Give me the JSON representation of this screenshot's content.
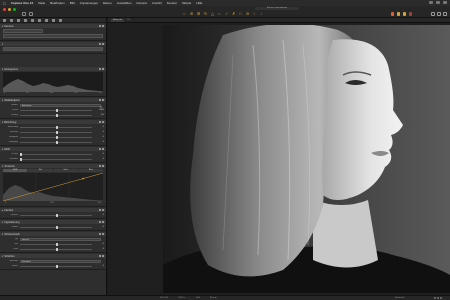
{
  "menubar": {
    "app_name": "Capture One 12",
    "items": [
      "Datei",
      "Bearbeiten",
      "Bild",
      "Anpassungen",
      "Ebene",
      "Auswählen",
      "Kamera",
      "Ansicht",
      "Fenster",
      "Skripte",
      "Hilfe"
    ]
  },
  "window_title": "Bettina ueberarbeitet",
  "viewer": {
    "tab_active": "Bettina.tif",
    "tab_other": "Fit"
  },
  "left_panel": {
    "header_label": "Kamera",
    "sections": {
      "histogram": {
        "title": "Histogramm",
        "scale": [
          "0",
          "64",
          "128",
          "192",
          "255"
        ]
      },
      "white_balance": {
        "title": "Weißabgleich",
        "mode_label": "Modus",
        "mode_value": "Aufnahme",
        "rows": [
          {
            "label": "Kelvin",
            "value": "5000"
          },
          {
            "label": "Tönung",
            "value": "0,0"
          }
        ]
      },
      "exposure": {
        "title": "Belichtung",
        "rows": [
          {
            "label": "Belichtung",
            "value": "0"
          },
          {
            "label": "Kontrast",
            "value": "0"
          },
          {
            "label": "Helligkeit",
            "value": "0"
          },
          {
            "label": "Sättigung",
            "value": "0"
          }
        ]
      },
      "hdr": {
        "title": "HDR",
        "rows": [
          {
            "label": "Lichter",
            "value": "0"
          },
          {
            "label": "Schatten",
            "value": "0"
          }
        ]
      },
      "curve": {
        "title": "Tonwerte",
        "tabs": [
          "RGB",
          "Rot",
          "Grün",
          "Blau"
        ],
        "vals": [
          "0",
          "128",
          "255"
        ]
      },
      "clarity": {
        "title": "Klarheit",
        "rows": [
          {
            "label": "Klarheit",
            "value": "0"
          }
        ]
      },
      "vignette": {
        "title": "Vignettierung",
        "rows": [
          {
            "label": "Stärke",
            "value": "0"
          }
        ]
      },
      "bw": {
        "title": "Schwarzweiß",
        "mode_label": "Typ",
        "mode_value": "Neutral",
        "rows": [
          {
            "label": "Rot",
            "value": "0"
          },
          {
            "label": "Gelb",
            "value": "0"
          }
        ]
      },
      "sharpen": {
        "title": "Schärfen",
        "mode_label": "Methode",
        "mode_value": "Standard",
        "rows": [
          {
            "label": "Stärke",
            "value": "0"
          }
        ]
      }
    }
  },
  "status": {
    "left": "ISO 100",
    "mid1": "1/125 s",
    "mid2": "f/5,6",
    "mid3": "85 mm",
    "right": "Bettina.tif"
  },
  "colors": {
    "accent": "#d6a23a",
    "panel": "#2e2e2e",
    "traffic": [
      "#e0443e",
      "#dea123",
      "#1aab29"
    ]
  }
}
